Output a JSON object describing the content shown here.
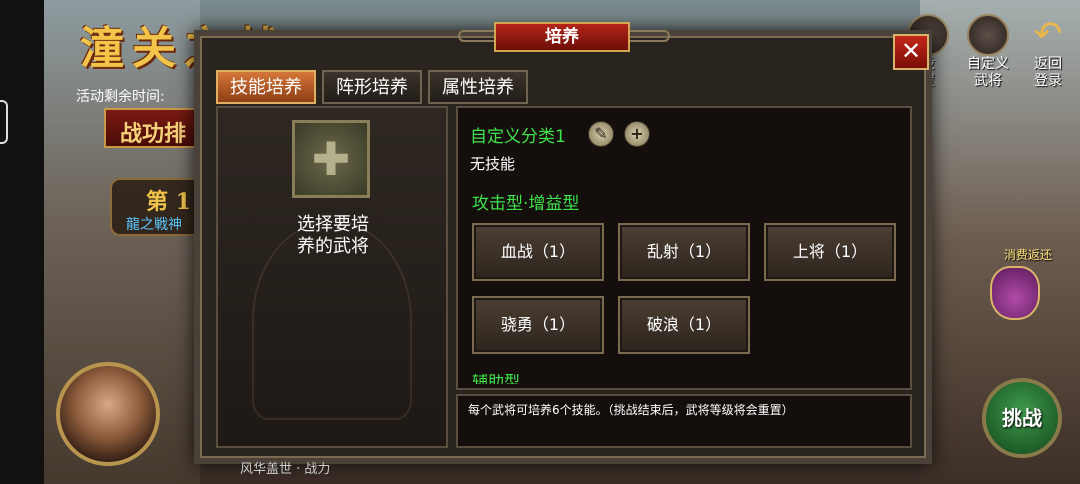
{
  "background": {
    "event_title": "潼关之战",
    "remain_label": "活动剩余时间:",
    "banner": "战功排",
    "rank": {
      "number": "第 1",
      "name": "龍之戦神"
    },
    "top_icons": [
      {
        "label_line1": "设",
        "label_line2": "置",
        "icon": "settings-icon"
      },
      {
        "label_line1": "自定义",
        "label_line2": "武将",
        "icon": "custom-general-icon"
      },
      {
        "label_line1": "返回",
        "label_line2": "登录",
        "icon": "back-arrow-icon"
      }
    ],
    "rebate": "消费返还",
    "challenge": "挑战",
    "bottom_text": "风华盖世 · 战力"
  },
  "modal": {
    "title": "培养",
    "close": "✕",
    "tabs": [
      {
        "label": "技能培养",
        "active": true
      },
      {
        "label": "阵形培养",
        "active": false
      },
      {
        "label": "属性培养",
        "active": false
      }
    ],
    "left": {
      "add_symbol": "✚",
      "hint_line1": "选择要培",
      "hint_line2": "养的武将"
    },
    "right": {
      "category_title": "自定义分类1",
      "edit_symbol": "✎",
      "add_symbol": "+",
      "no_skill": "无技能",
      "type_title": "攻击型·增益型",
      "skills": [
        "血战（1）",
        "乱射（1）",
        "上将（1）",
        "骁勇（1）",
        "破浪（1）"
      ],
      "next_category": "辅助型"
    },
    "info": "每个武将可培养6个技能。（挑战结束后，武将等级将会重置）"
  }
}
